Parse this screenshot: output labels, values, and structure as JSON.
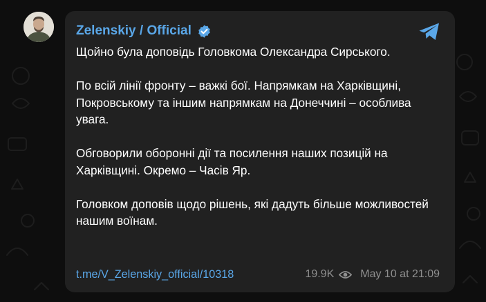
{
  "post": {
    "channel_name": "Zelenskiy / Official",
    "paragraphs": [
      "Щойно була доповідь Головкома Олександра Сирського.",
      "По всій лінії фронту – важкі бої. Напрямкам на Харківщині, Покровському та іншим напрямкам на Донеччині – особлива увага.",
      "Обговорили оборонні дії та посилення наших позицій на Харківщині. Окремо – Часів Яр.",
      "Головком доповів щодо рішень, які дадуть більше можливостей нашим воїнам."
    ],
    "link": "t.me/V_Zelenskiy_official/10318",
    "views": "19.9K",
    "timestamp": "May 10 at 21:09"
  },
  "colors": {
    "background": "#0e0e0e",
    "card": "#212121",
    "accent": "#5aa7e8",
    "text": "#ffffff",
    "muted": "#8f8f8f"
  },
  "icons": {
    "verified": "verified-badge-icon",
    "share": "telegram-share-icon",
    "views": "eye-icon"
  }
}
